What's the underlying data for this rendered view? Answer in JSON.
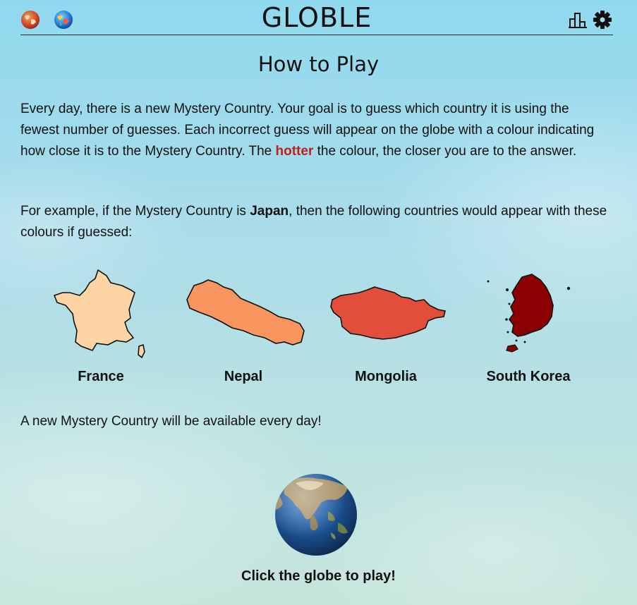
{
  "header": {
    "brand": "GLOBLE",
    "left_icons": [
      "globe-game-icon",
      "rainbow-globe-icon"
    ],
    "right_icons": [
      "statistics-icon",
      "settings-icon"
    ]
  },
  "main": {
    "heading": "How to Play",
    "intro_before_hot": "Every day, there is a new Mystery Country. Your goal is to guess which country it is using the fewest number of guesses. Each incorrect guess will appear on the globe with a colour indicating how close it is to the Mystery Country. The ",
    "hot_word": "hotter",
    "intro_after_hot": " the colour, the closer you are to the answer.",
    "example_before": "For example, if the Mystery Country is ",
    "example_country": "Japan",
    "example_after": ", then the following countries would appear with these colours if guessed:",
    "examples": [
      {
        "name": "France",
        "color": "#fdd5a4",
        "icon": "france-shape-icon"
      },
      {
        "name": "Nepal",
        "color": "#f9955f",
        "icon": "nepal-shape-icon"
      },
      {
        "name": "Mongolia",
        "color": "#e34e3a",
        "icon": "mongolia-shape-icon"
      },
      {
        "name": "South Korea",
        "color": "#8b0000",
        "icon": "south-korea-shape-icon"
      }
    ],
    "daily_note": "A new Mystery Country will be available every day!",
    "globe_icon": "earth-globe-icon",
    "play_prompt": "Click the globe to play!"
  },
  "colors": {
    "hot_text": "#c0201c",
    "text": "#111111"
  }
}
